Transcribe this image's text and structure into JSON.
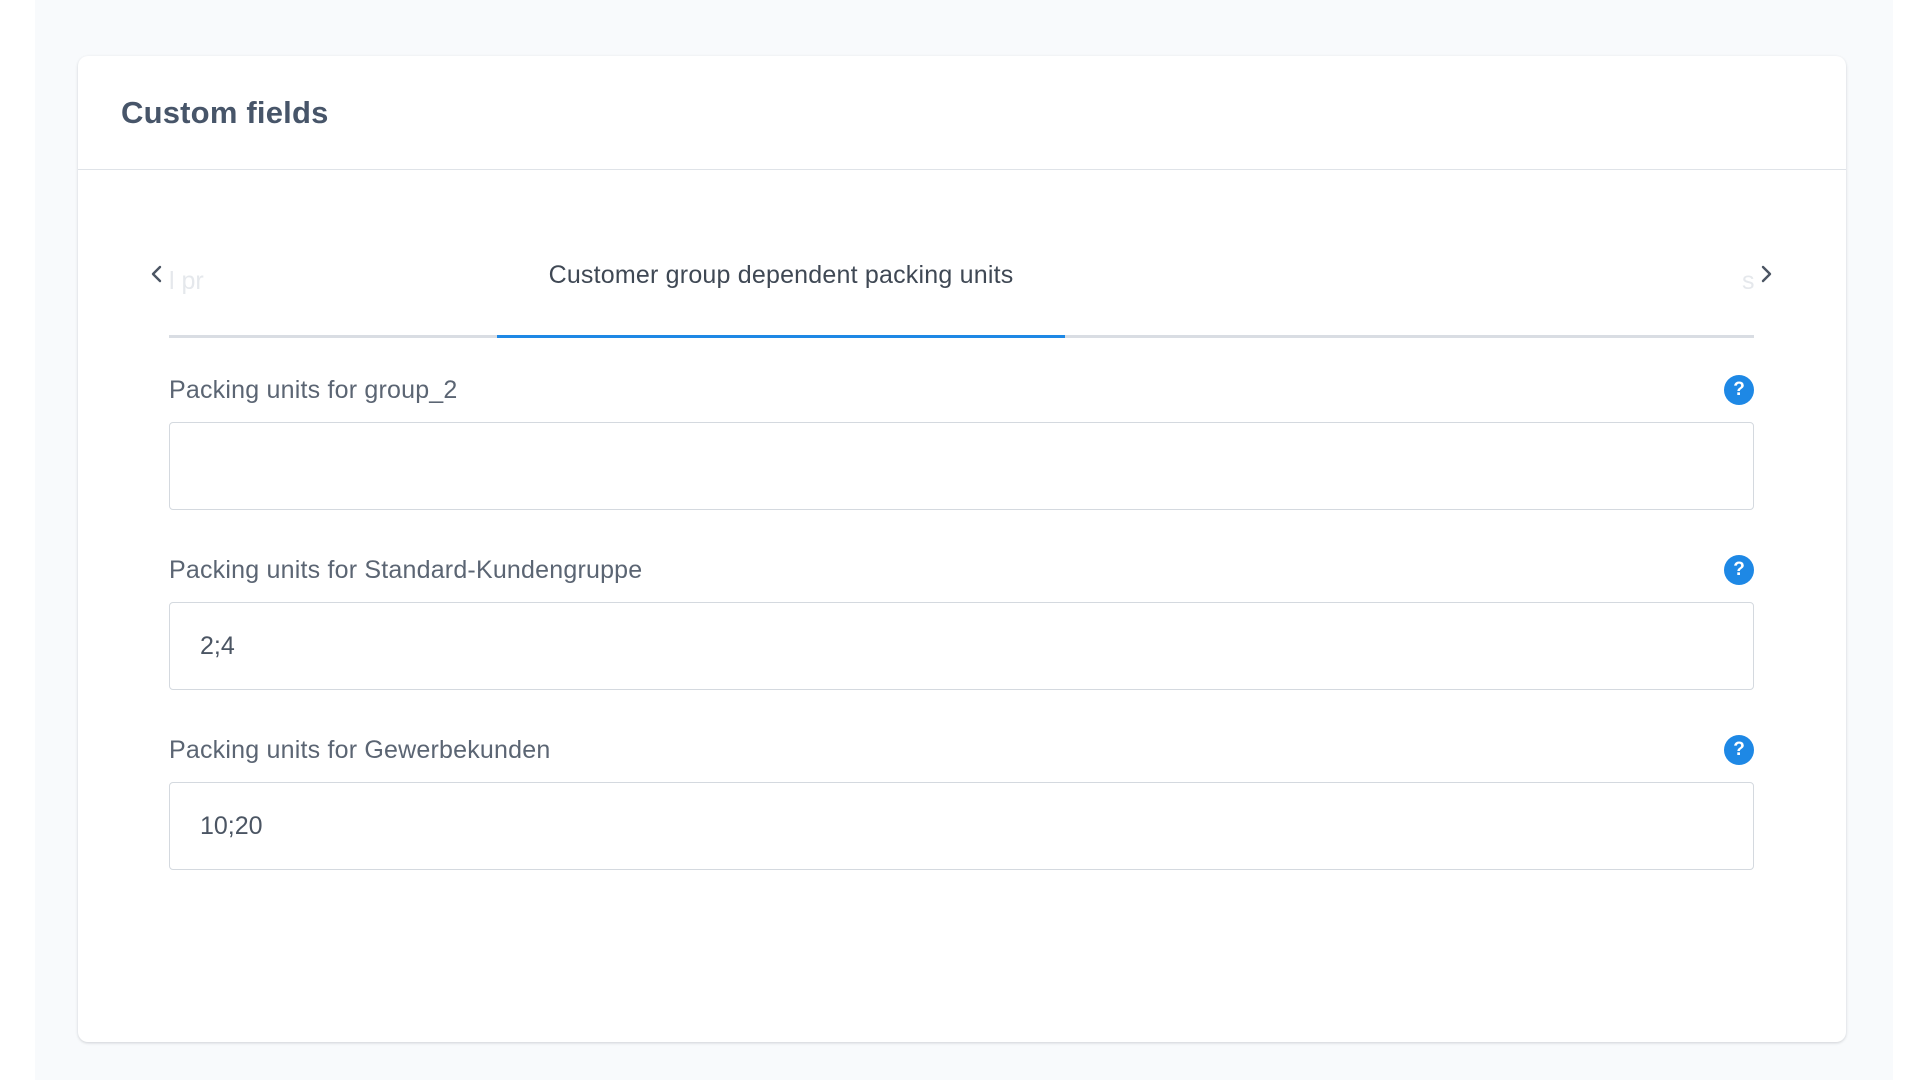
{
  "card": {
    "title": "Custom fields"
  },
  "tabs": {
    "partial_left_label": "l pr",
    "partial_right_label": "s",
    "active_label": "Customer group dependent packing units"
  },
  "icons": {
    "prev": "chevron-left-icon",
    "next": "chevron-right-icon",
    "help": "question-circle-icon",
    "help_glyph": "?"
  },
  "colors": {
    "accent": "#1e88e5",
    "text_muted": "#5b6573",
    "title": "#475569"
  },
  "fields": [
    {
      "label": "Packing units for group_2",
      "value": ""
    },
    {
      "label": "Packing units for Standard-Kundengruppe",
      "value": "2;4"
    },
    {
      "label": "Packing units for Gewerbekunden",
      "value": "10;20"
    }
  ]
}
